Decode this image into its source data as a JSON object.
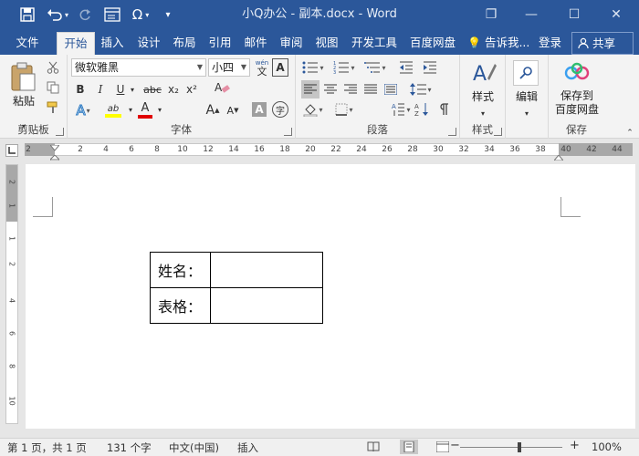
{
  "window": {
    "title": "小Q办公 - 副本.docx - Word",
    "quick_access": {
      "save_icon": "save-icon",
      "undo_icon": "undo-icon",
      "redo_icon": "redo-icon",
      "omega_glyph": "Ω",
      "save_glyph": "🖫",
      "undo_glyph": "↶",
      "redo_glyph": "↻"
    },
    "controls": {
      "restore_glyph": "❐",
      "minimize_glyph": "—",
      "maximize_glyph": "☐",
      "close_glyph": "✕"
    }
  },
  "tabs": [
    "文件",
    "开始",
    "插入",
    "设计",
    "布局",
    "引用",
    "邮件",
    "审阅",
    "视图",
    "开发工具",
    "百度网盘"
  ],
  "active_tab": "开始",
  "tell_me": "告诉我...",
  "sign_in": "登录",
  "share": "共享",
  "ribbon": {
    "clipboard": {
      "label": "剪贴板",
      "paste": "粘贴"
    },
    "font": {
      "label": "字体",
      "font_name": "微软雅黑",
      "font_size": "小四",
      "wen_glyph": "wén",
      "bold": "B",
      "italic": "I",
      "underline": "U",
      "strike": "abc",
      "subscript": "x₂",
      "superscript": "x²",
      "grow": "A",
      "shrink": "A",
      "shade": "A",
      "circle": "字",
      "effect": "A",
      "highlight": "ab",
      "color": "A"
    },
    "paragraph": {
      "label": "段落"
    },
    "styles": {
      "label": "样式",
      "button": "样式"
    },
    "editing": {
      "button": "编辑"
    },
    "save": {
      "label": "保存",
      "button_line1": "保存到",
      "button_line2": "百度网盘"
    },
    "accent_color": "#2b579a"
  },
  "ruler": {
    "numbers": [
      "2",
      "2",
      "4",
      "6",
      "8",
      "10",
      "12",
      "14",
      "16",
      "18",
      "20",
      "22",
      "24",
      "26",
      "28",
      "30",
      "32",
      "34",
      "36",
      "38",
      "40",
      "42",
      "44"
    ],
    "vertical_numbers": [
      "2",
      "1",
      "1",
      "2",
      "4",
      "6",
      "8",
      "10"
    ]
  },
  "document": {
    "table": [
      {
        "label": "姓名：",
        "value": ""
      },
      {
        "label": "表格：",
        "value": ""
      }
    ]
  },
  "status": {
    "page": "第 1 页，共 1 页",
    "words": "131 个字",
    "language": "中文(中国)",
    "mode": "插入",
    "zoom": "100%",
    "zoom_minus": "−",
    "zoom_plus": "+"
  }
}
